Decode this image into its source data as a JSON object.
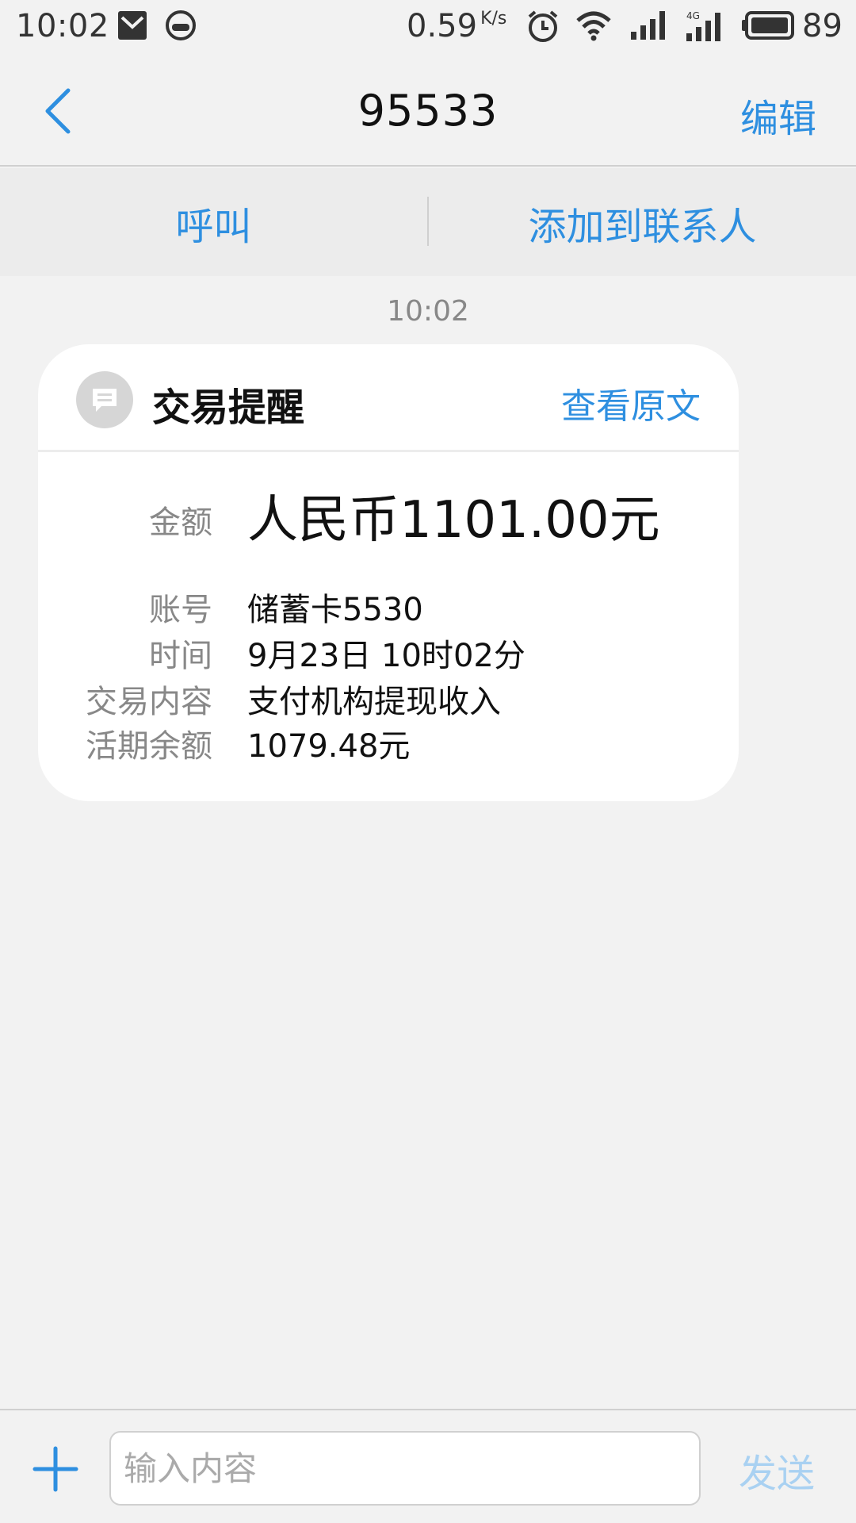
{
  "status_bar": {
    "time": "10:02",
    "network_speed": "0.59",
    "speed_unit": "K/s",
    "battery_level": "89"
  },
  "nav": {
    "title": "95533",
    "edit_label": "编辑"
  },
  "actions": {
    "call_label": "呼叫",
    "add_contact_label": "添加到联系人"
  },
  "message": {
    "time": "10:02",
    "card": {
      "title": "交易提醒",
      "view_original_label": "查看原文",
      "rows": [
        {
          "label": "金额",
          "value": "人民币1101.00元"
        },
        {
          "label": "账号",
          "value": "储蓄卡5530"
        },
        {
          "label": "时间",
          "value": "9月23日 10时02分"
        },
        {
          "label": "交易内容",
          "value": "支付机构提现收入"
        },
        {
          "label": "活期余额",
          "value": "1079.48元"
        }
      ]
    }
  },
  "composer": {
    "placeholder": "输入内容",
    "send_label": "发送"
  },
  "colors": {
    "accent": "#2e8fe0",
    "send_disabled": "#a9d1f2",
    "background": "#f2f2f2"
  }
}
